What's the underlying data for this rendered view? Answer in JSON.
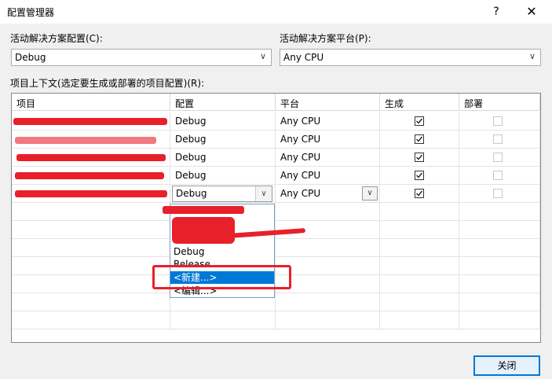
{
  "window": {
    "title": "配置管理器",
    "help": "?",
    "close": "✕"
  },
  "solution_config": {
    "label": "活动解决方案配置(C):",
    "value": "Debug"
  },
  "solution_platform": {
    "label": "活动解决方案平台(P):",
    "value": "Any CPU"
  },
  "grid_label": "项目上下文(选定要生成或部署的项目配置)(R):",
  "columns": [
    "项目",
    "配置",
    "平台",
    "生成",
    "部署"
  ],
  "rows": [
    {
      "project": "",
      "config": "Debug",
      "platform": "Any CPU",
      "build": true,
      "deploy": false
    },
    {
      "project": "",
      "config": "Debug",
      "platform": "Any CPU",
      "build": true,
      "deploy": false
    },
    {
      "project": "",
      "config": "Debug",
      "platform": "Any CPU",
      "build": true,
      "deploy": false
    },
    {
      "project": "",
      "config": "Debug",
      "platform": "Any CPU",
      "build": true,
      "deploy": false
    },
    {
      "project": "",
      "config": "Debug",
      "platform": "Any CPU",
      "build": true,
      "deploy": false
    }
  ],
  "dropdown": {
    "items": [
      "Debug",
      "Release",
      "<新建...>",
      "<编辑...>"
    ],
    "selected": "<新建...>"
  },
  "close_button": "关闭",
  "colors": {
    "selection": "#0078d7",
    "redaction": "#e8202a"
  }
}
